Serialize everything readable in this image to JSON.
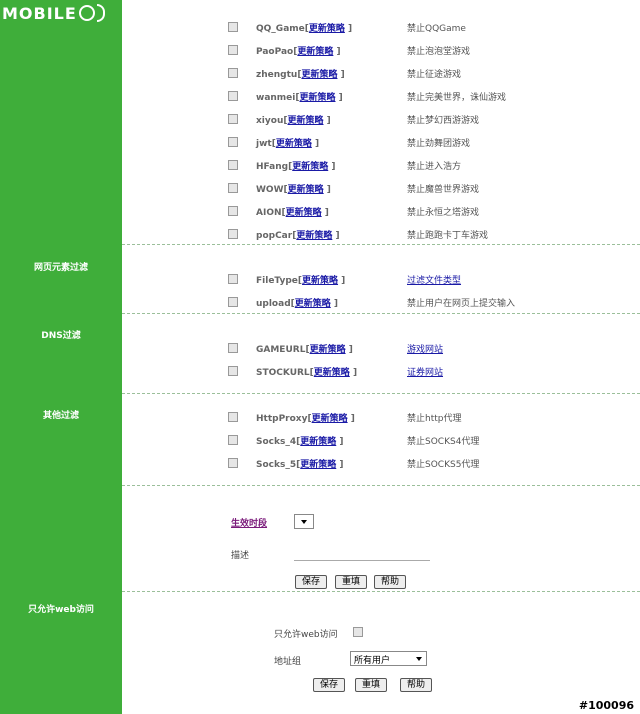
{
  "brand": {
    "logo_text": "MOBILE"
  },
  "sections": [
    {
      "title": "",
      "rows": [
        {
          "name": "QQ_Game",
          "link": "更新策略",
          "desc": "禁止QQGame",
          "desc_is_link": false
        },
        {
          "name": "PaoPao",
          "link": "更新策略",
          "desc": "禁止泡泡堂游戏",
          "desc_is_link": false
        },
        {
          "name": "zhengtu",
          "link": "更新策略",
          "desc": "禁止征途游戏",
          "desc_is_link": false
        },
        {
          "name": "wanmei",
          "link": "更新策略",
          "desc": "禁止完美世界，诛仙游戏",
          "desc_is_link": false
        },
        {
          "name": "xiyou",
          "link": "更新策略",
          "desc": "禁止梦幻西游游戏",
          "desc_is_link": false
        },
        {
          "name": "jwt",
          "link": "更新策略",
          "desc": "禁止劲舞团游戏",
          "desc_is_link": false
        },
        {
          "name": "HFang",
          "link": "更新策略",
          "desc": "禁止进入浩方",
          "desc_is_link": false
        },
        {
          "name": "WOW",
          "link": "更新策略",
          "desc": "禁止魔兽世界游戏",
          "desc_is_link": false
        },
        {
          "name": "AION",
          "link": "更新策略",
          "desc": "禁止永恒之塔游戏",
          "desc_is_link": false
        },
        {
          "name": "popCar",
          "link": "更新策略",
          "desc": "禁止跑跑卡丁车游戏",
          "desc_is_link": false
        }
      ]
    },
    {
      "title": "网页元素过滤",
      "rows": [
        {
          "name": "FileType",
          "link": "更新策略",
          "desc": "过滤文件类型",
          "desc_is_link": true
        },
        {
          "name": "upload",
          "link": "更新策略",
          "desc": "禁止用户在网页上提交输入",
          "desc_is_link": false
        }
      ]
    },
    {
      "title": "DNS过滤",
      "rows": [
        {
          "name": "GAMEURL",
          "link": "更新策略",
          "desc": "游戏网站",
          "desc_is_link": true
        },
        {
          "name": "STOCKURL",
          "link": "更新策略",
          "desc": "证券网站",
          "desc_is_link": true
        }
      ]
    },
    {
      "title": "其他过滤",
      "rows": [
        {
          "name": "HttpProxy",
          "link": "更新策略",
          "desc": "禁止http代理",
          "desc_is_link": false
        },
        {
          "name": "Socks_4",
          "link": "更新策略",
          "desc": "禁止SOCKS4代理",
          "desc_is_link": false
        },
        {
          "name": "Socks_5",
          "link": "更新策略",
          "desc": "禁止SOCKS5代理",
          "desc_is_link": false
        }
      ]
    }
  ],
  "schedule": {
    "effective_time_label": "生效时段",
    "description_label": "描述",
    "description_value": "",
    "buttons": {
      "save": "保存",
      "reset": "重填",
      "help": "帮助"
    }
  },
  "web_only": {
    "section_title": "只允许web访问",
    "checkbox_label": "只允许web访问",
    "address_group_label": "地址组",
    "address_group_value": "所有用户",
    "buttons": {
      "save": "保存",
      "reset": "重填",
      "help": "帮助"
    }
  },
  "watermark": "#100096"
}
